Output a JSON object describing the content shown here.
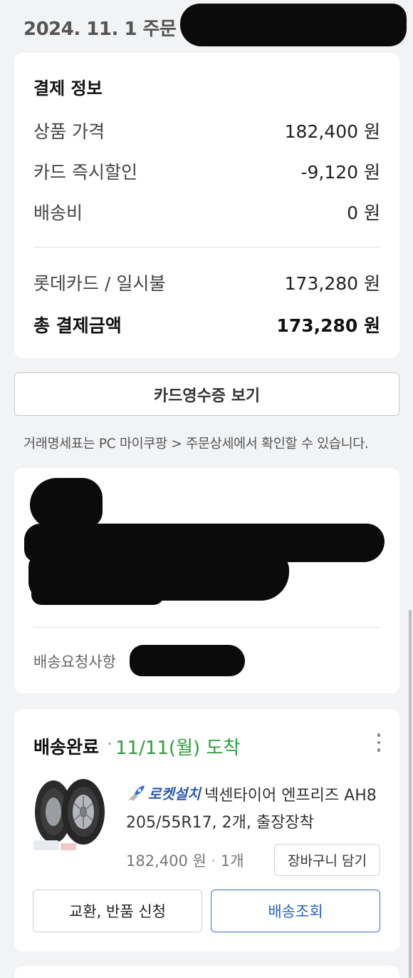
{
  "header": {
    "order_date": "2024. 11. 1 주문"
  },
  "payment": {
    "title": "결제 정보",
    "rows": [
      {
        "label": "상품 가격",
        "value": "182,400 원"
      },
      {
        "label": "카드 즉시할인",
        "value": "-9,120 원"
      },
      {
        "label": "배송비",
        "value": "0 원"
      }
    ],
    "method": {
      "label": "롯데카드 / 일시불",
      "value": "173,280 원"
    },
    "total": {
      "label": "총 결제금액",
      "value": "173,280 원"
    }
  },
  "receipt_button": "카드영수증 보기",
  "notice": "거래명세표는 PC 마이쿠팡 > 주문상세에서 확인할 수 있습니다.",
  "address": {
    "request_label": "배송요청사항"
  },
  "shipment": {
    "status": "배송완료",
    "separator": "·",
    "arrival": "11/11(월) 도착",
    "badge": "로켓설치",
    "product_name": "넥센타이어 엔프리즈 AH8 205/55R17, 2개, 출장장착",
    "price": "182,400 원",
    "qty": "1개",
    "cart_button": "장바구니 담기",
    "exchange_button": "교환, 반품 신청",
    "track_button": "배송조회"
  },
  "colors": {
    "arrival_green": "#2e9e3a",
    "accent_blue": "#2a62cc",
    "redaction": "#0b0b0b"
  },
  "icons": {
    "more": "more-vertical-icon",
    "badge": "rocket-install-icon"
  }
}
